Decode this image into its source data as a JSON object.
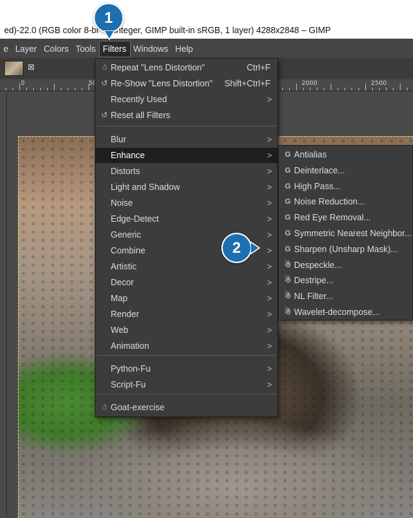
{
  "window": {
    "title": "ed)-22.0 (RGB color 8-bi a integer, GIMP built-in sRGB, 1 layer) 4288x2848 – GIMP"
  },
  "menubar": {
    "items": [
      "e",
      "Layer",
      "Colors",
      "Tools",
      "Filters",
      "Windows",
      "Help"
    ],
    "active": "Filters"
  },
  "ruler": {
    "labels": [
      "0",
      "50",
      "2000",
      "2500"
    ]
  },
  "tab": {
    "close_glyph": "⊠"
  },
  "filters_menu": {
    "items": [
      {
        "icon": "☃",
        "label": "Repeat \"Lens Distortion\"",
        "accel": "Ctrl+F"
      },
      {
        "icon": "↺",
        "label": "Re-Show \"Lens Distortion\"",
        "accel": "Shift+Ctrl+F"
      },
      {
        "icon": "",
        "label": "Recently Used",
        "submenu": true
      },
      {
        "icon": "↺",
        "label": "Reset all Filters"
      },
      {
        "icon": "",
        "label": "Blur",
        "submenu": true
      },
      {
        "icon": "",
        "label": "Enhance",
        "submenu": true,
        "highlighted": true
      },
      {
        "icon": "",
        "label": "Distorts",
        "submenu": true
      },
      {
        "icon": "",
        "label": "Light and Shadow",
        "submenu": true
      },
      {
        "icon": "",
        "label": "Noise",
        "submenu": true
      },
      {
        "icon": "",
        "label": "Edge-Detect",
        "submenu": true
      },
      {
        "icon": "",
        "label": "Generic",
        "submenu": true
      },
      {
        "icon": "",
        "label": "Combine",
        "submenu": true
      },
      {
        "icon": "",
        "label": "Artistic",
        "submenu": true
      },
      {
        "icon": "",
        "label": "Decor",
        "submenu": true
      },
      {
        "icon": "",
        "label": "Map",
        "submenu": true
      },
      {
        "icon": "",
        "label": "Render",
        "submenu": true
      },
      {
        "icon": "",
        "label": "Web",
        "submenu": true
      },
      {
        "icon": "",
        "label": "Animation",
        "submenu": true
      },
      {
        "icon": "",
        "label": "Python-Fu",
        "submenu": true
      },
      {
        "icon": "",
        "label": "Script-Fu",
        "submenu": true
      },
      {
        "icon": "☃",
        "label": "Goat-exercise"
      }
    ]
  },
  "enhance_menu": {
    "items": [
      {
        "icon": "G",
        "label": "Antialias"
      },
      {
        "icon": "G",
        "label": "Deinterlace..."
      },
      {
        "icon": "G",
        "label": "High Pass..."
      },
      {
        "icon": "G",
        "label": "Noise Reduction..."
      },
      {
        "icon": "G",
        "label": "Red Eye Removal..."
      },
      {
        "icon": "G",
        "label": "Symmetric Nearest Neighbor..."
      },
      {
        "icon": "G",
        "label": "Sharpen (Unsharp Mask)..."
      },
      {
        "icon": "☃",
        "label": "Despeckle..."
      },
      {
        "icon": "☃",
        "label": "Destripe..."
      },
      {
        "icon": "☃",
        "label": "NL Filter..."
      },
      {
        "icon": "☃",
        "label": "Wavelet-decompose..."
      }
    ]
  },
  "callouts": {
    "step1": "1",
    "step2": "2",
    "color": "#1d6fb0"
  },
  "arrow_glyph": ">"
}
